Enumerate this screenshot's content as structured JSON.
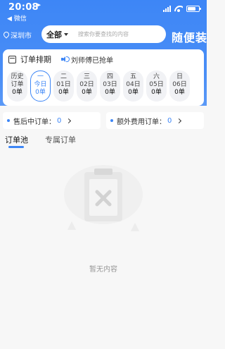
{
  "status_bar": {
    "time": "20:08",
    "back_label": "◀ 微信"
  },
  "search": {
    "city": "深圳市",
    "scope": "全部",
    "placeholder": "搜索你要查找的内容"
  },
  "brand": "随便装",
  "order_card": {
    "title": "订单排期",
    "notice": "刘师傅已抢单",
    "days": [
      {
        "line1": "历史",
        "line2": "订单",
        "count": "0单",
        "active": false
      },
      {
        "line1": "一",
        "line2": "今日",
        "count": "0单",
        "active": true
      },
      {
        "line1": "二",
        "line2": "01日",
        "count": "0单",
        "active": false
      },
      {
        "line1": "三",
        "line2": "02日",
        "count": "0单",
        "active": false
      },
      {
        "line1": "四",
        "line2": "03日",
        "count": "0单",
        "active": false
      },
      {
        "line1": "五",
        "line2": "04日",
        "count": "0单",
        "active": false
      },
      {
        "line1": "六",
        "line2": "05日",
        "count": "0单",
        "active": false
      },
      {
        "line1": "日",
        "line2": "06日",
        "count": "0单",
        "active": false
      }
    ]
  },
  "summary": {
    "after_sale_label": "售后中订单：",
    "after_sale_count": "0",
    "extra_fee_label": "额外费用订单：",
    "extra_fee_count": "0"
  },
  "tabs": [
    "订单池",
    "专属订单"
  ],
  "empty_text": "暂无内容",
  "colors": {
    "accent": "#3d86f6",
    "background": "#f7f7f7"
  }
}
